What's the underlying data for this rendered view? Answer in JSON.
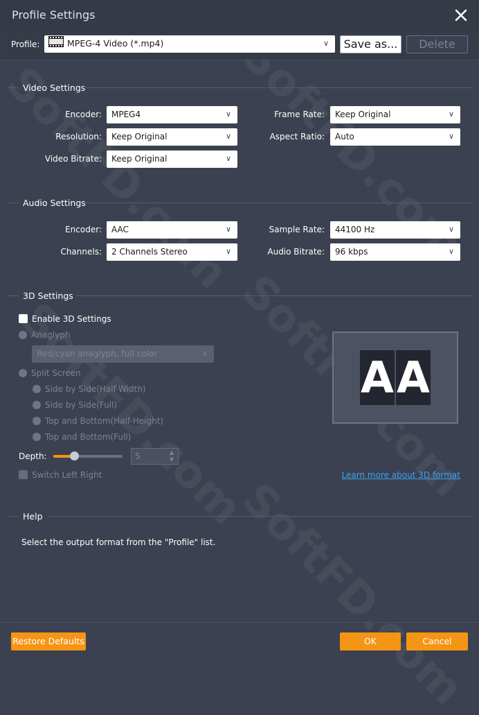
{
  "window": {
    "title": "Profile Settings"
  },
  "profile": {
    "label": "Profile:",
    "value": "MPEG-4 Video (*.mp4)",
    "save_as_label": "Save as...",
    "delete_label": "Delete"
  },
  "video": {
    "section_title": "Video Settings",
    "encoder_label": "Encoder:",
    "encoder_value": "MPEG4",
    "resolution_label": "Resolution:",
    "resolution_value": "Keep Original",
    "bitrate_label": "Video Bitrate:",
    "bitrate_value": "Keep Original",
    "frame_rate_label": "Frame Rate:",
    "frame_rate_value": "Keep Original",
    "aspect_ratio_label": "Aspect Ratio:",
    "aspect_ratio_value": "Auto"
  },
  "audio": {
    "section_title": "Audio Settings",
    "encoder_label": "Encoder:",
    "encoder_value": "AAC",
    "channels_label": "Channels:",
    "channels_value": "2 Channels Stereo",
    "sample_rate_label": "Sample Rate:",
    "sample_rate_value": "44100 Hz",
    "bitrate_label": "Audio Bitrate:",
    "bitrate_value": "96 kbps"
  },
  "three_d": {
    "section_title": "3D Settings",
    "enable_label": "Enable 3D Settings",
    "enabled": false,
    "anaglyph_label": "Anaglyph",
    "anaglyph_value": "Red/cyan anaglyph, full color",
    "split_screen_label": "Split Screen",
    "split_options": [
      "Side by Side(Half-Width)",
      "Side by Side(Full)",
      "Top and Bottom(Half-Height)",
      "Top and Bottom(Full)"
    ],
    "depth_label": "Depth:",
    "depth_value": "5",
    "depth_slider_fraction": 0.3,
    "switch_label": "Switch Left Right",
    "learn_more": "Learn more about 3D format",
    "preview_letters": [
      "A",
      "A"
    ]
  },
  "help": {
    "section_title": "Help",
    "text": "Select the output format from the \"Profile\" list."
  },
  "footer": {
    "restore_label": "Restore Defaults",
    "ok_label": "OK",
    "cancel_label": "Cancel"
  },
  "watermark": "SoftFD.com",
  "colors": {
    "accent": "#f59515",
    "background": "#3b4150",
    "link": "#3da2f2"
  }
}
